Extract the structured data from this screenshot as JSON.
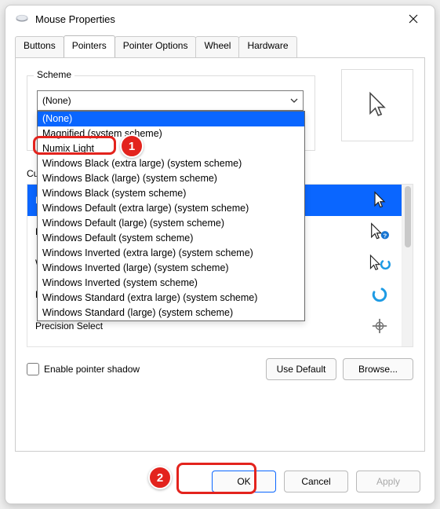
{
  "window": {
    "title": "Mouse Properties"
  },
  "tabs": {
    "items": [
      "Buttons",
      "Pointers",
      "Pointer Options",
      "Wheel",
      "Hardware"
    ],
    "active": "Pointers"
  },
  "scheme": {
    "legend": "Scheme",
    "current": "(None)",
    "options": [
      "(None)",
      "Magnified (system scheme)",
      "Numix Light",
      "Windows Black (extra large) (system scheme)",
      "Windows Black (large) (system scheme)",
      "Windows Black (system scheme)",
      "Windows Default (extra large) (system scheme)",
      "Windows Default (large) (system scheme)",
      "Windows Default (system scheme)",
      "Windows Inverted (extra large) (system scheme)",
      "Windows Inverted (large) (system scheme)",
      "Windows Inverted (system scheme)",
      "Windows Standard (extra large) (system scheme)",
      "Windows Standard (large) (system scheme)"
    ],
    "selected_index": 0
  },
  "customize": {
    "label": "Customize:",
    "items": [
      {
        "name": "Normal Select",
        "icon": "cursor-white"
      },
      {
        "name": "Help Select",
        "icon": "cursor-help"
      },
      {
        "name": "Working In Background",
        "icon": "cursor-busy-bg"
      },
      {
        "name": "Busy",
        "icon": "busy-circle"
      },
      {
        "name": "Precision Select",
        "icon": "crosshair"
      }
    ],
    "selected_index": 0
  },
  "checkbox": {
    "label": "Enable pointer shadow",
    "checked": false
  },
  "buttons": {
    "use_default": "Use Default",
    "browse": "Browse...",
    "ok": "OK",
    "cancel": "Cancel",
    "apply": "Apply"
  },
  "annotations": {
    "badge1": "1",
    "badge2": "2"
  }
}
